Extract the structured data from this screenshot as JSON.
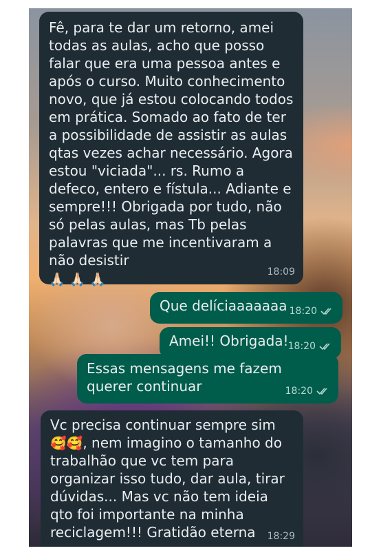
{
  "messages": [
    {
      "id": "m1",
      "direction": "incoming",
      "text": "Fê, para te dar um retorno, amei todas as aulas, acho que posso falar que era uma pessoa antes e após o curso. Muito conhecimento novo, que já estou colocando todos em prática. Somado ao fato de ter a possibilidade de assistir as aulas qtas vezes achar necessário. Agora estou \"viciada\"... rs. Rumo a defeco, entero e fístula... Adiante e sempre!!! Obrigada por tudo, não só pelas aulas, mas Tb pelas palavras que me incentivaram a não desistir",
      "emoji": "🙏🏻 🙏🏻 🙏🏻",
      "time": "18:09"
    },
    {
      "id": "m2",
      "direction": "outgoing",
      "text": "Que delíciaaaaaaa",
      "time": "18:20",
      "status_icon": "double-check-icon"
    },
    {
      "id": "m3",
      "direction": "outgoing",
      "text": "Amei!! Obrigada!",
      "time": "18:20",
      "status_icon": "double-check-icon"
    },
    {
      "id": "m4",
      "direction": "outgoing",
      "text": "Essas mensagens me fazem querer continuar",
      "time": "18:20",
      "status_icon": "double-check-icon"
    },
    {
      "id": "m5",
      "direction": "incoming",
      "text_before_emoji": "Vc precisa continuar sempre sim",
      "emoji": "🥰🥰",
      "text_after_emoji": ", nem imagino o tamanho do trabalhão que vc tem para organizar isso tudo, dar aula, tirar dúvidas... Mas vc não tem ideia qto foi importante na minha reciclagem!!! Gratidão eterna",
      "time": "18:29"
    }
  ],
  "colors": {
    "incoming_bubble": "#1f2c34",
    "outgoing_bubble": "#005c4b",
    "message_text": "#e9edef"
  }
}
